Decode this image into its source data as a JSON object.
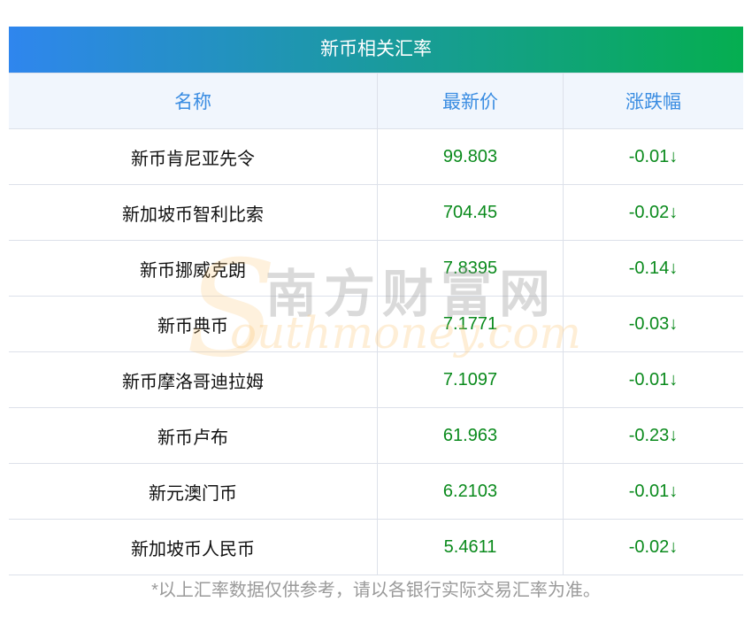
{
  "title": "新币相关汇率",
  "columns": [
    "名称",
    "最新价",
    "涨跌幅"
  ],
  "rows": [
    {
      "name": "新币肯尼亚先令",
      "price": "99.803",
      "change": "-0.01↓"
    },
    {
      "name": "新加坡币智利比索",
      "price": "704.45",
      "change": "-0.02↓"
    },
    {
      "name": "新币挪威克朗",
      "price": "7.8395",
      "change": "-0.14↓"
    },
    {
      "name": "新币典币",
      "price": "7.1771",
      "change": "-0.03↓"
    },
    {
      "name": "新币摩洛哥迪拉姆",
      "price": "7.1097",
      "change": "-0.01↓"
    },
    {
      "name": "新币卢布",
      "price": "61.963",
      "change": "-0.23↓"
    },
    {
      "name": "新元澳门币",
      "price": "6.2103",
      "change": "-0.01↓"
    },
    {
      "name": "新加坡币人民币",
      "price": "5.4611",
      "change": "-0.02↓"
    }
  ],
  "footnote": "*以上汇率数据仅供参考，请以各银行实际交易汇率为准。",
  "watermark": {
    "cn": "南方财富网",
    "en": "outhmoney.com",
    "s": "S"
  },
  "colors": {
    "header_start": "#2f86ee",
    "header_end": "#05ae50",
    "column_header": "#3b8de2",
    "down": "#0a8a1c"
  }
}
